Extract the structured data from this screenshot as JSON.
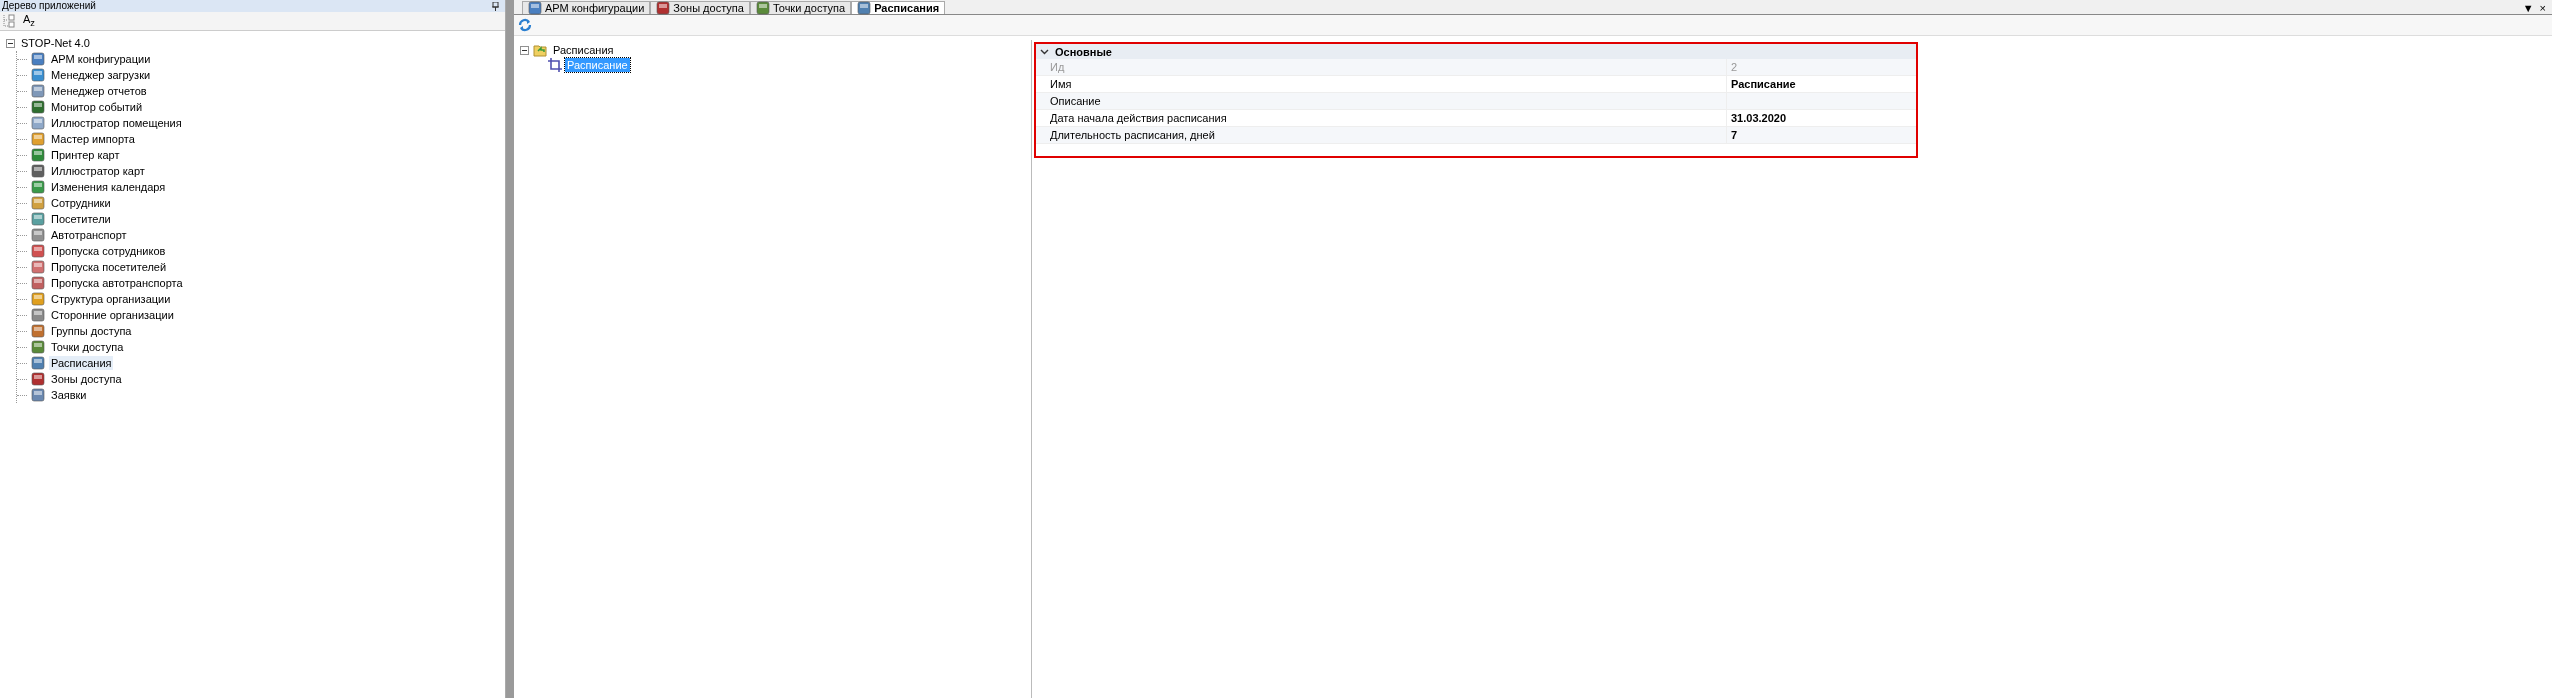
{
  "app_tree_panel": {
    "title": "Дерево приложений",
    "sort_button": "A$_{z}$",
    "tree": {
      "label": "STOP-Net 4.0",
      "expanded": true,
      "children": [
        {
          "label": "АРМ конфигурации",
          "selected": false
        },
        {
          "label": "Менеджер загрузки",
          "selected": false
        },
        {
          "label": "Менеджер отчетов",
          "selected": false
        },
        {
          "label": "Монитор событий",
          "selected": false
        },
        {
          "label": "Иллюстратор помещения",
          "selected": false
        },
        {
          "label": "Мастер импорта",
          "selected": false
        },
        {
          "label": "Принтер карт",
          "selected": false
        },
        {
          "label": "Иллюстратор карт",
          "selected": false
        },
        {
          "label": "Изменения календаря",
          "selected": false
        },
        {
          "label": "Сотрудники",
          "selected": false
        },
        {
          "label": "Посетители",
          "selected": false
        },
        {
          "label": "Автотранспорт",
          "selected": false
        },
        {
          "label": "Пропуска сотрудников",
          "selected": false
        },
        {
          "label": "Пропуска посетителей",
          "selected": false
        },
        {
          "label": "Пропуска автотранспорта",
          "selected": false
        },
        {
          "label": "Структура организации",
          "selected": false
        },
        {
          "label": "Сторонние организации",
          "selected": false
        },
        {
          "label": "Группы доступа",
          "selected": false
        },
        {
          "label": "Точки доступа",
          "selected": false
        },
        {
          "label": "Расписания",
          "selected": true
        },
        {
          "label": "Зоны доступа",
          "selected": false
        },
        {
          "label": "Заявки",
          "selected": false
        }
      ]
    }
  },
  "tabs": [
    {
      "label": "АРМ конфигурации",
      "selected": false
    },
    {
      "label": "Зоны доступа",
      "selected": false
    },
    {
      "label": "Точки доступа",
      "selected": false
    },
    {
      "label": "Расписания",
      "selected": true
    }
  ],
  "tab_strip_buttons": [
    "▼",
    "×"
  ],
  "schedule_tree": {
    "label": "Расписания",
    "expanded": true,
    "children": [
      {
        "label": "Расписание",
        "selected": true
      }
    ]
  },
  "properties": {
    "category": "Основные",
    "expanded": true,
    "rows": [
      {
        "name": "Ид",
        "value": "2",
        "disabled": true
      },
      {
        "name": "Имя",
        "value": "Расписание",
        "disabled": false
      },
      {
        "name": "Описание",
        "disabled": false
      },
      {
        "name": "Дата начала действия расписания",
        "value": "31.03.2020",
        "disabled": false
      },
      {
        "name": "Длительность расписания, дней",
        "value": "7",
        "disabled": false
      }
    ]
  }
}
